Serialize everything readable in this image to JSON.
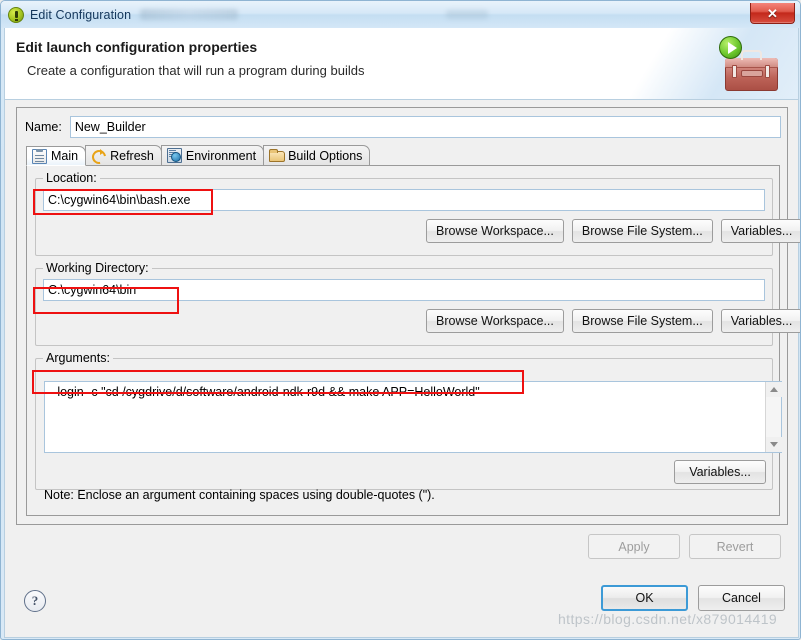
{
  "window": {
    "title": "Edit Configuration",
    "title_icon": "info-green-icon",
    "close_label": "✕"
  },
  "header": {
    "title": "Edit launch configuration properties",
    "subtitle": "Create a configuration that will run a program during builds",
    "icon": "toolbox-with-play-badge-icon"
  },
  "form": {
    "name_label": "Name:",
    "name_value": "New_Builder",
    "name_placeholder": "Name"
  },
  "tabs": [
    {
      "label": "Main",
      "icon": "clipboard-icon",
      "active": true
    },
    {
      "label": "Refresh",
      "icon": "refresh-arrows-icon",
      "active": false
    },
    {
      "label": "Environment",
      "icon": "environment-icon",
      "active": false
    },
    {
      "label": "Build Options",
      "icon": "folder-icon",
      "active": false
    }
  ],
  "location": {
    "group_label": "Location:",
    "value": "C:\\cygwin64\\bin\\bash.exe",
    "placeholder": "",
    "buttons": [
      "Browse Workspace...",
      "Browse File System...",
      "Variables..."
    ]
  },
  "working_directory": {
    "group_label": "Working Directory:",
    "value": "C:\\cygwin64\\bin",
    "placeholder": "",
    "buttons": [
      "Browse Workspace...",
      "Browse File System...",
      "Variables..."
    ]
  },
  "arguments": {
    "group_label": "Arguments:",
    "value": "--login -c \"cd /cygdrive/d/software/android-ndk-r9d && make APP=HelloWorld\"",
    "placeholder": "",
    "buttons": [
      "Variables..."
    ],
    "scroll_up_icon": "triangle-up-icon",
    "scroll_down_icon": "triangle-down-icon"
  },
  "note": "Note: Enclose an argument containing spaces using double-quotes (\").",
  "actions": {
    "apply": "Apply",
    "revert": "Revert",
    "ok": "OK",
    "cancel": "Cancel",
    "help_icon": "question-mark-icon",
    "help_glyph": "?"
  },
  "watermark": "https://blog.csdn.net/x879014419",
  "colors": {
    "annotation": "#ee1111",
    "default_button_focus": "#3c9ad6",
    "titlebar_text": "#14375c",
    "close_button": "#c3281b"
  }
}
